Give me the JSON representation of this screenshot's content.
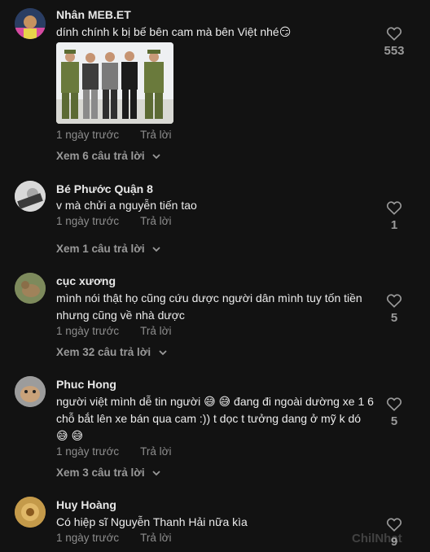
{
  "comments": [
    {
      "username": "Nhân MEB.ET",
      "text": "dính chính k bị bế bên cam mà bên Việt nhé😏",
      "time": "1 ngày trước",
      "reply": "Trả lời",
      "view_replies": "Xem 6 câu trả lời",
      "likes": "553",
      "has_image": true
    },
    {
      "username": "Bé Phước Quận 8",
      "text": "v mà chửi a nguyễn tiến tao",
      "time": "1 ngày trước",
      "reply": "Trả lời",
      "view_replies": "Xem 1 câu trả lời",
      "likes": "1"
    },
    {
      "username": "cục xương",
      "text": "mình nói thật họ cũng cứu dược người dân mình tuy tốn tiền nhưng cũng về nhà dược",
      "time": "1 ngày trước",
      "reply": "Trả lời",
      "view_replies": "Xem 32 câu trả lời",
      "likes": "5"
    },
    {
      "username": "Phuc Hong",
      "text": "người việt mình dễ tin người 😅 😅  đang đi ngoài dường xe 1 6 chỗ bắt lên xe bán qua cam :)) t dọc t tưởng dang ở mỹ k dó 😅 😅",
      "time": "1 ngày trước",
      "reply": "Trả lời",
      "view_replies": "Xem 3 câu trả lời",
      "likes": "5"
    },
    {
      "username": "Huy Hoàng",
      "text": "Có hiệp sĩ Nguyễn Thanh Hải nữa kìa",
      "time": "1 ngày trước",
      "reply": "Trả lời",
      "likes": "9"
    }
  ],
  "watermark": "ChilNhat",
  "colors": {
    "background": "#121212",
    "muted": "#8d8d8d",
    "text": "#ececec"
  }
}
